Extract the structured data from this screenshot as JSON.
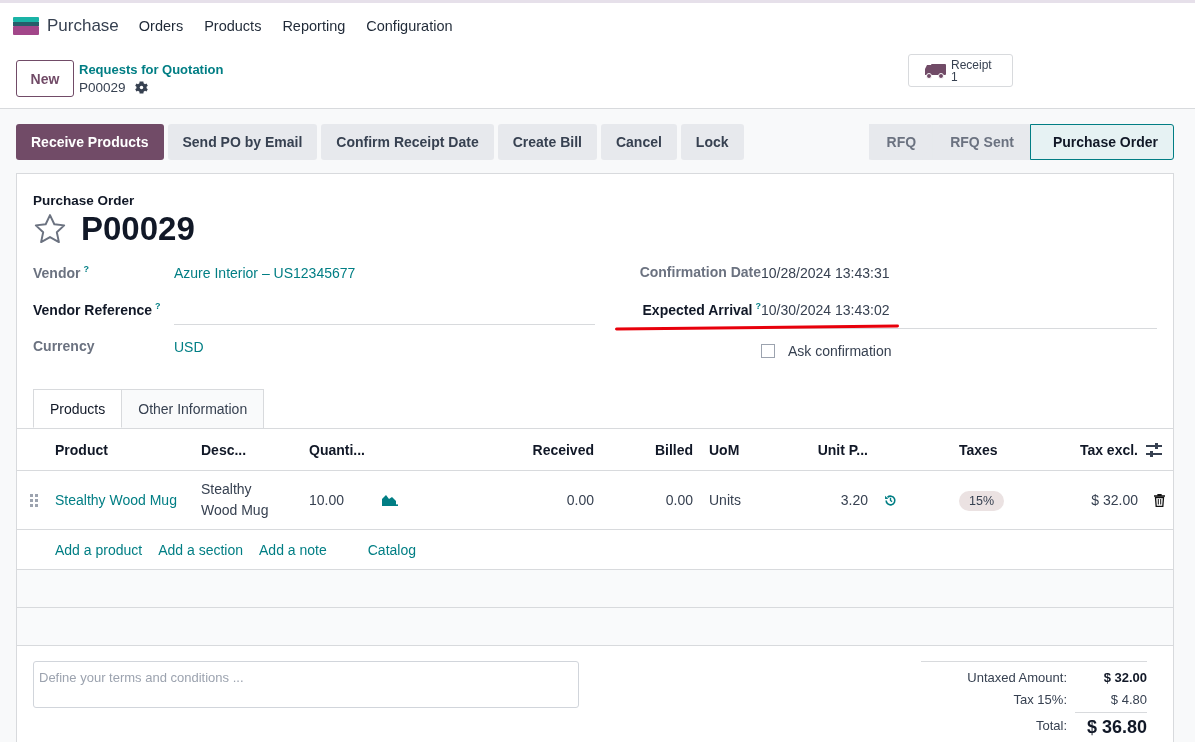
{
  "app": {
    "name": "Purchase",
    "menu": [
      "Orders",
      "Products",
      "Reporting",
      "Configuration"
    ]
  },
  "control_panel": {
    "new_button": "New",
    "breadcrumb_parent": "Requests for Quotation",
    "breadcrumb_current": "P00029",
    "smart_button": {
      "label": "Receipt",
      "count": "1"
    }
  },
  "actions": [
    {
      "label": "Receive Products",
      "primary": true
    },
    {
      "label": "Send PO by Email",
      "primary": false
    },
    {
      "label": "Confirm Receipt Date",
      "primary": false
    },
    {
      "label": "Create Bill",
      "primary": false
    },
    {
      "label": "Cancel",
      "primary": false
    },
    {
      "label": "Lock",
      "primary": false
    }
  ],
  "stages": [
    {
      "label": "RFQ",
      "selected": false
    },
    {
      "label": "RFQ Sent",
      "selected": false
    },
    {
      "label": "Purchase Order",
      "selected": true
    }
  ],
  "form": {
    "type_label": "Purchase Order",
    "name": "P00029",
    "starred": false
  },
  "fields_left": [
    {
      "label": "Vendor",
      "help": "?",
      "required": false,
      "kind": "link",
      "value": "Azure Interior – US12345677"
    },
    {
      "label": "Vendor Reference",
      "help": "?",
      "required": true,
      "kind": "input"
    },
    {
      "label": "Currency",
      "required": false,
      "kind": "link",
      "value": "USD"
    }
  ],
  "fields_right": [
    {
      "label": "Confirmation Date",
      "required": false,
      "kind": "text",
      "value": "10/28/2024 13:43:31",
      "underlined": false
    },
    {
      "label": "Expected Arrival",
      "help": "?",
      "required": true,
      "kind": "text",
      "value": "10/30/2024 13:43:02",
      "underlined": true
    }
  ],
  "ask_confirmation": {
    "label": "Ask confirmation",
    "checked": false
  },
  "tabs": [
    {
      "label": "Products",
      "selected": true
    },
    {
      "label": "Other Information",
      "selected": false
    }
  ],
  "table": {
    "columns": [
      "Product",
      "Desc...",
      "Quanti...",
      "Received",
      "Billed",
      "UoM",
      "Unit P...",
      "Taxes",
      "Tax excl."
    ],
    "rows": [
      {
        "product": "Stealthy Wood Mug",
        "description": "Stealthy Wood Mug",
        "quantity": "10.00",
        "received": "0.00",
        "billed": "0.00",
        "uom": "Units",
        "unit_price": "3.20",
        "taxes": [
          "15%"
        ],
        "subtotal": "$ 32.00"
      }
    ],
    "add_links": [
      "Add a product",
      "Add a section",
      "Add a note",
      "Catalog"
    ]
  },
  "terms": {
    "placeholder": "Define your terms and conditions ..."
  },
  "totals": [
    {
      "label": "Untaxed Amount:",
      "value": "$ 32.00",
      "kind": "subtotal"
    },
    {
      "label": "Tax 15%:",
      "value": "$ 4.80",
      "kind": "tax"
    },
    {
      "label": "Total:",
      "value": "$ 36.80",
      "kind": "total"
    }
  ]
}
